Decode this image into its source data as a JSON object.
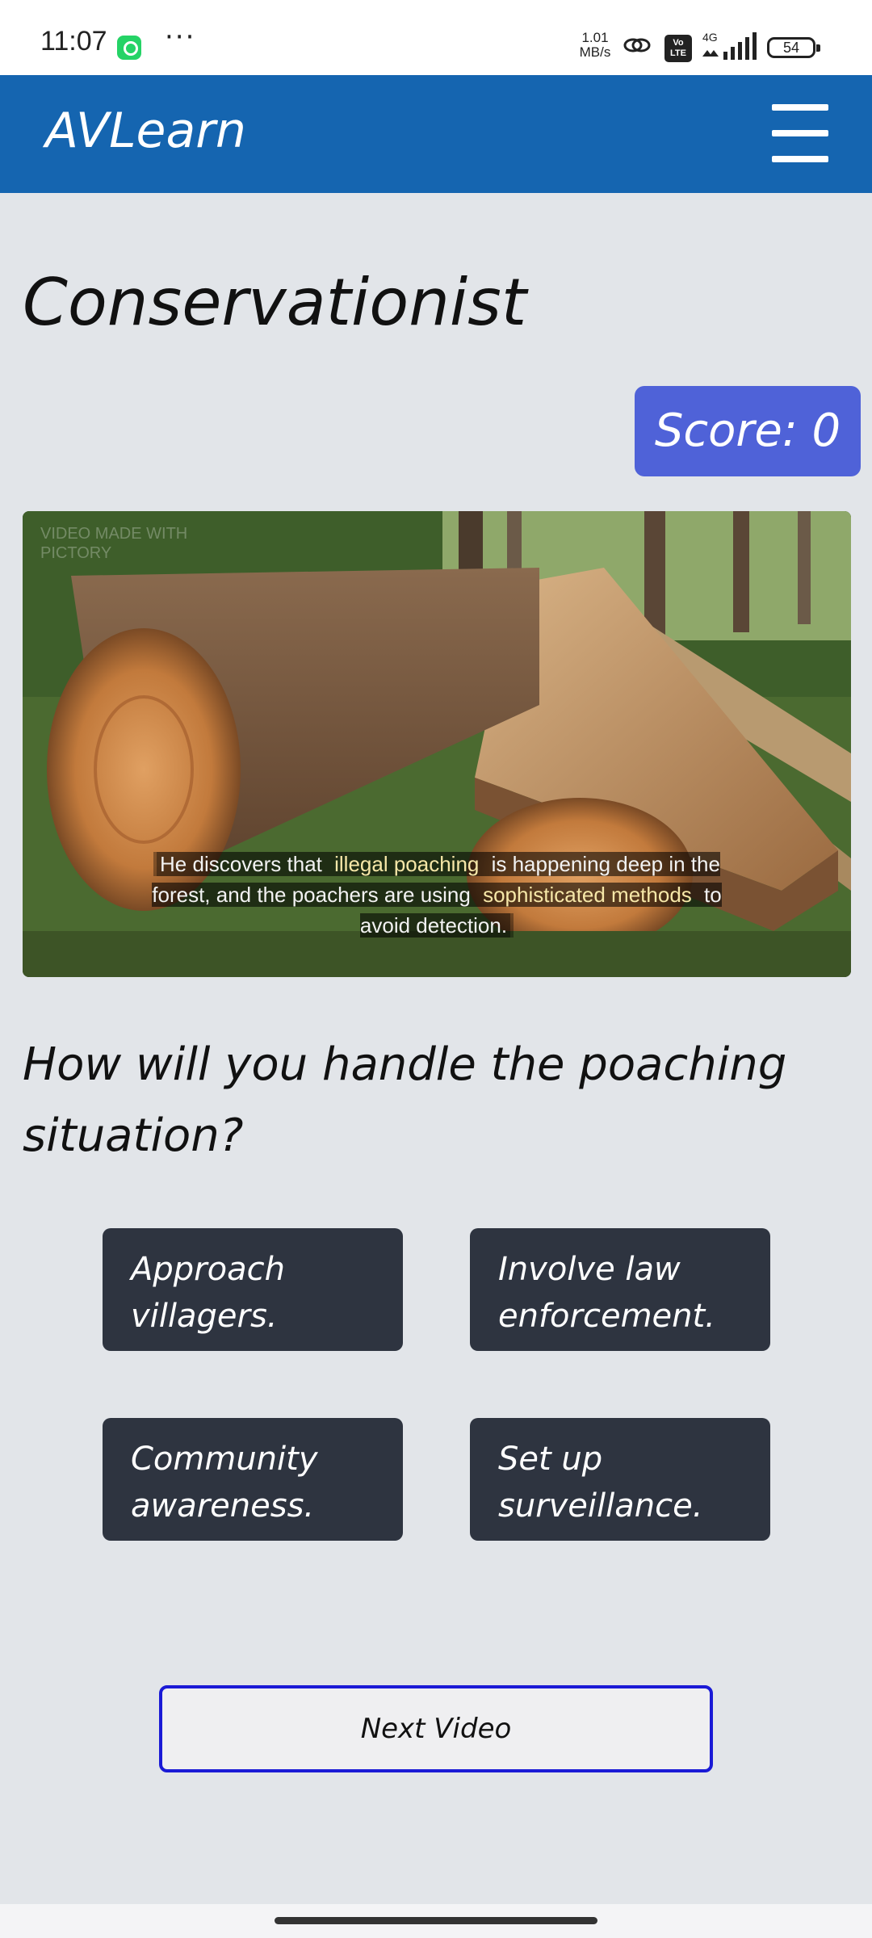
{
  "status_bar": {
    "time": "11:07",
    "dots": "···",
    "speed_value": "1.01",
    "speed_unit": "MB/s",
    "volte": "Vo LTE",
    "network": "4G",
    "battery": "54",
    "icons": [
      "whatsapp-icon",
      "link-icon",
      "volte-icon",
      "signal-icon",
      "battery-icon"
    ]
  },
  "header": {
    "title": "AVLearn",
    "menu_icon": "hamburger-menu-icon",
    "color": "#1565b0"
  },
  "page": {
    "title": "Conservationist",
    "score_label": "Score: 0"
  },
  "video": {
    "watermark_line1": "VIDEO MADE WITH",
    "watermark_line2": "PICTORY",
    "caption_part1": "He discovers that ",
    "caption_hl1": "illegal poaching",
    "caption_part2": " is happening deep in the forest, and the poachers are using ",
    "caption_hl2": "sophisticated methods",
    "caption_part3": " to avoid detection."
  },
  "question": "How will you handle the poaching situation?",
  "options": [
    {
      "line1": "Approach",
      "line2": "villagers."
    },
    {
      "line1": "Involve law",
      "line2": "enforcement."
    },
    {
      "line1": "Community",
      "line2": "awareness."
    },
    {
      "line1": "Set up",
      "line2": "surveillance."
    }
  ],
  "next_button": "Next Video",
  "colors": {
    "background": "#e2e5e9",
    "score_bg": "#4f62d8",
    "option_bg": "#2e3440",
    "next_border": "#1a1ad6"
  }
}
